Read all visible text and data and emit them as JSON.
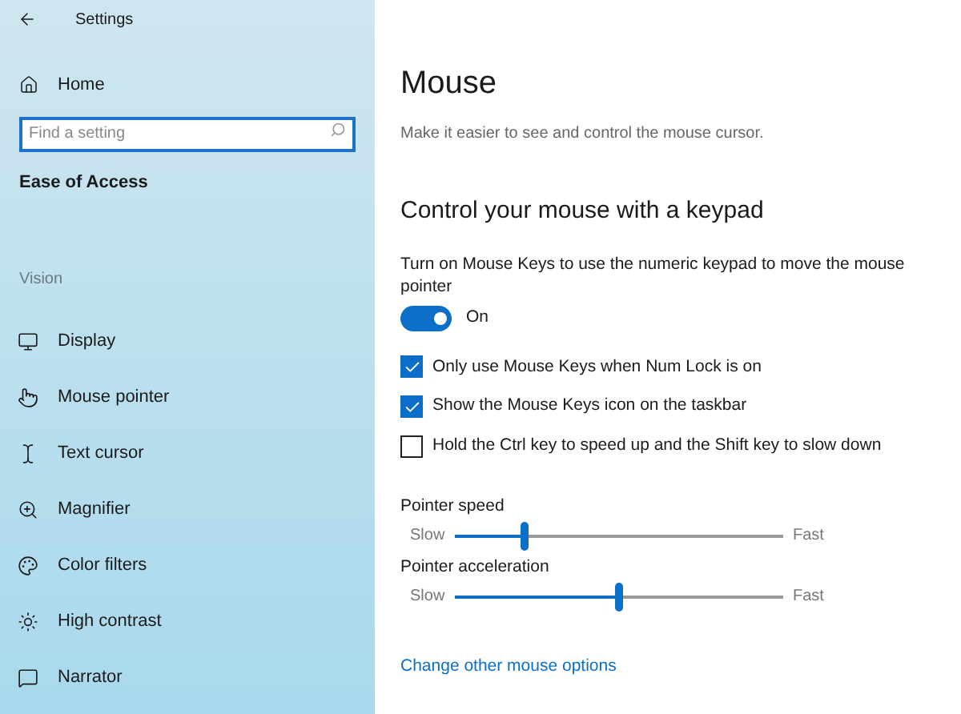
{
  "window": {
    "title": "Settings"
  },
  "sidebar": {
    "home": "Home",
    "search": {
      "placeholder": "Find a setting"
    },
    "section": "Ease of Access",
    "group": "Vision",
    "items": [
      {
        "label": "Display",
        "kind": "display"
      },
      {
        "label": "Mouse pointer",
        "kind": "pointer"
      },
      {
        "label": "Text cursor",
        "kind": "cursor"
      },
      {
        "label": "Magnifier",
        "kind": "magnifier"
      },
      {
        "label": "Color filters",
        "kind": "palette"
      },
      {
        "label": "High contrast",
        "kind": "contrast"
      },
      {
        "label": "Narrator",
        "kind": "narrator"
      }
    ]
  },
  "page": {
    "title": "Mouse",
    "subtitle": "Make it easier to see and control the mouse cursor.",
    "heading": "Control your mouse with a keypad",
    "toggle": {
      "description": "Turn on Mouse Keys to use the numeric keypad to move the mouse pointer",
      "on": true,
      "state_label": "On"
    },
    "checkboxes": [
      {
        "label": "Only use Mouse Keys when Num Lock is on",
        "checked": true
      },
      {
        "label": "Show the Mouse Keys icon on the taskbar",
        "checked": true
      },
      {
        "label": "Hold the Ctrl key to speed up and the Shift key to slow down",
        "checked": false
      }
    ],
    "sliders": [
      {
        "label": "Pointer speed",
        "min_label": "Slow",
        "max_label": "Fast",
        "level": 0.21
      },
      {
        "label": "Pointer acceleration",
        "min_label": "Slow",
        "max_label": "Fast",
        "level": 0.5
      }
    ],
    "link": "Change other mouse options"
  }
}
